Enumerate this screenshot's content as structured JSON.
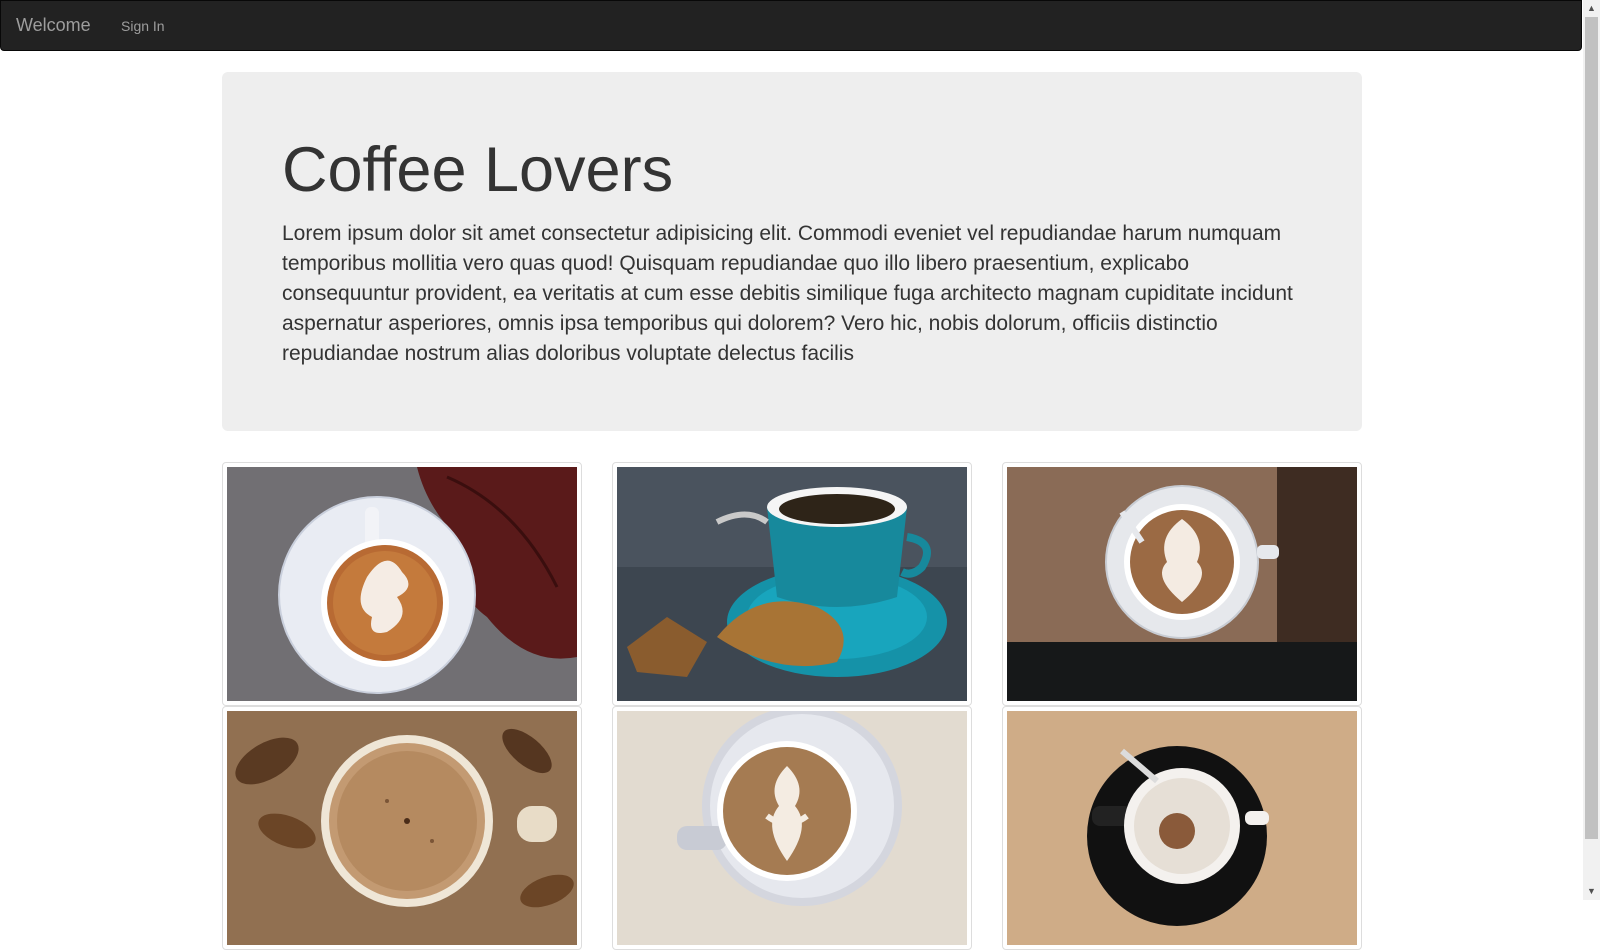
{
  "navbar": {
    "brand": "Welcome",
    "links": [
      {
        "label": "Sign In"
      }
    ]
  },
  "hero": {
    "title": "Coffee Lovers",
    "text": "Lorem ipsum dolor sit amet consectetur adipisicing elit. Commodi eveniet vel repudiandae harum numquam temporibus mollitia vero quas quod! Quisquam repudiandae quo illo libero praesentium, explicabo consequuntur provident, ea veritatis at cum esse debitis similique fuga architecto magnam cupiditate incidunt aspernatur asperiores, omnis ipsa temporibus qui dolorem? Vero hic, nobis dolorum, officiis distinctio repudiandae nostrum alias doloribus voluptate delectus facilis"
  },
  "gallery": {
    "photos": [
      {
        "subject": "latte-art-with-red-leaf"
      },
      {
        "subject": "espresso-blue-cup-with-biscotti"
      },
      {
        "subject": "cappuccino-on-wood-table"
      },
      {
        "subject": "frothy-coffee-on-autumn-leaves"
      },
      {
        "subject": "latte-art-tulip-cup"
      },
      {
        "subject": "empty-espresso-cup-black-saucer"
      }
    ]
  },
  "icons": {
    "scroll_up": "scroll-up-arrow-icon",
    "scroll_down": "scroll-down-arrow-icon"
  },
  "colors": {
    "navbar_bg": "#222222",
    "nav_text": "#9d9d9d",
    "jumbotron_bg": "#eeeeee"
  }
}
